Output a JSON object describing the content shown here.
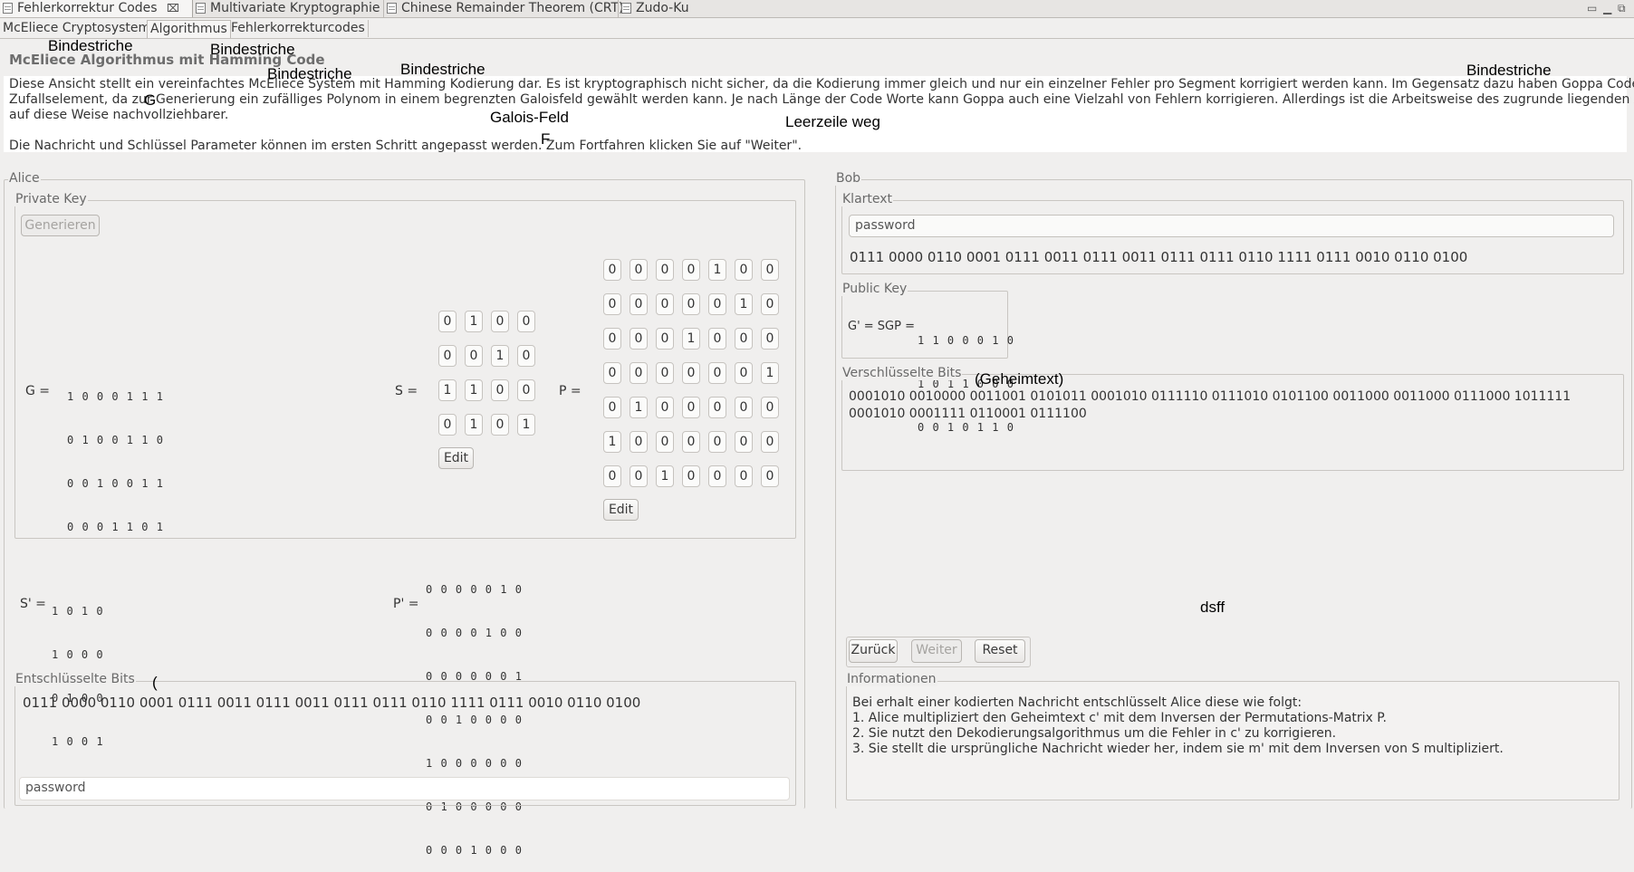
{
  "editor_tabs": [
    {
      "label": "Fehlerkorrektur Codes",
      "close": "⌧"
    },
    {
      "label": "Multivariate Kryptographie"
    },
    {
      "label": "Chinese Remainder Theorem (CRT)"
    },
    {
      "label": "Zudo-Ku"
    }
  ],
  "sub_tabs": [
    "McEliece Cryptosystem",
    "Algorithmus",
    "Fehlerkorrekturcodes"
  ],
  "overlays": {
    "bindestriche": "Bindestriche",
    "g": "G",
    "galois": "Galois-Feld",
    "f": "F",
    "leerzeile": "Leerzeile weg",
    "geheimtext": "(Geheimtext)",
    "dsff": "dsff",
    "paren": "("
  },
  "description": {
    "title": "McEliece Algorithmus mit Hamming Code",
    "line1": "Diese Ansicht stellt ein vereinfachtes McEliece System mit Hamming Kodierung dar. Es ist kryptographisch nicht sicher, da die Kodierung immer gleich und nur ein einzelner Fehler pro Segment korrigiert werden kann. Im Gegensatz dazu haben Goppa Codes ein",
    "line2": "Zufallselement, da zur Generierung ein zufälliges Polynom in einem begrenzten Galoisfeld gewählt werden kann. Je nach Länge der Code Worte kann Goppa auch eine Vielzahl von Fehlern korrigieren. Allerdings ist die Arbeitsweise des zugrunde liegenden Algorithmus",
    "line3": "auf diese Weise nachvollziehbarer.",
    "line4": "Die Nachricht und Schlüssel Parameter können im ersten Schritt angepasst werden. Zum Fortfahren klicken Sie auf \"Weiter\"."
  },
  "alice": {
    "title": "Alice",
    "private_key_label": "Private Key",
    "generate_button": "Generieren",
    "g_label": "G =",
    "g_rows": [
      "1 0 0 0 1 1 1",
      "0 1 0 0 1 1 0",
      "0 0 1 0 0 1 1",
      "0 0 0 1 1 0 1"
    ],
    "s_label": "S =",
    "s_matrix": [
      [
        "0",
        "1",
        "0",
        "0"
      ],
      [
        "0",
        "0",
        "1",
        "0"
      ],
      [
        "1",
        "1",
        "0",
        "0"
      ],
      [
        "0",
        "1",
        "0",
        "1"
      ]
    ],
    "s_edit": "Edit",
    "p_label": "P =",
    "p_matrix": [
      [
        "0",
        "0",
        "0",
        "0",
        "1",
        "0",
        "0"
      ],
      [
        "0",
        "0",
        "0",
        "0",
        "0",
        "1",
        "0"
      ],
      [
        "0",
        "0",
        "0",
        "1",
        "0",
        "0",
        "0"
      ],
      [
        "0",
        "0",
        "0",
        "0",
        "0",
        "0",
        "1"
      ],
      [
        "0",
        "1",
        "0",
        "0",
        "0",
        "0",
        "0"
      ],
      [
        "1",
        "0",
        "0",
        "0",
        "0",
        "0",
        "0"
      ],
      [
        "0",
        "0",
        "1",
        "0",
        "0",
        "0",
        "0"
      ]
    ],
    "p_edit": "Edit",
    "s_inv_label": "S' =",
    "s_inv_rows": [
      "1 0 1 0",
      "1 0 0 0",
      "0 1 0 0",
      "1 0 0 1"
    ],
    "p_inv_label": "P' =",
    "p_inv_rows": [
      "0 0 0 0 0 1 0",
      "0 0 0 0 1 0 0",
      "0 0 0 0 0 0 1",
      "0 0 1 0 0 0 0",
      "1 0 0 0 0 0 0",
      "0 1 0 0 0 0 0",
      "0 0 0 1 0 0 0"
    ],
    "decrypted_label": "Entschlüsselte Bits",
    "decrypted_bits": "0111 0000 0110 0001 0111 0011 0111 0011 0111 0111 0110 1111 0111 0010 0110 0100",
    "decrypted_text": "password"
  },
  "bob": {
    "title": "Bob",
    "plaintext_label": "Klartext",
    "plaintext_value": "password",
    "plaintext_bits": "0111 0000 0110 0001 0111 0011 0111 0011 0111 0111 0110 1111 0111 0010 0110 0100",
    "public_key_label": "Public Key",
    "public_key_eq": "G' = SGP =",
    "public_key_rows": [
      "1 1 0 0 0 1 0",
      "1 0 1 1 0 0 0",
      "0 0 1 0 1 1 0"
    ],
    "encrypted_label": "Verschlüsselte Bits",
    "encrypted_line1": "0001010 0010000 0011001 0101011 0001010 0111110 0111010 0101100 0011000 0011000 0111000 1011111",
    "encrypted_line2": "0001010 0001111 0110001 0111100",
    "back_button": "Zurück",
    "next_button": "Weiter",
    "reset_button": "Reset",
    "info_label": "Informationen",
    "info_lines": [
      "Bei erhalt einer kodierten Nachricht entschlüsselt Alice diese wie folgt:",
      "1. Alice multipliziert den Geheimtext c' mit dem Inversen der Permutations-Matrix P.",
      "2. Sie nutzt den Dekodierungsalgorithmus um die Fehler in c' zu korrigieren.",
      "3. Sie stellt die ursprüngliche Nachricht wieder her, indem sie m' mit dem Inversen von S multipliziert."
    ]
  }
}
